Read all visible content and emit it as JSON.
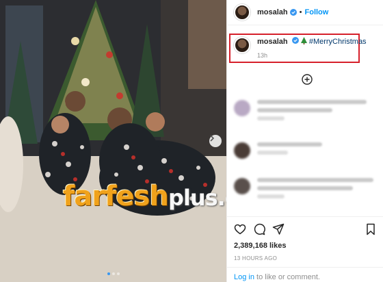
{
  "post": {
    "username": "mosalah",
    "follow_label": "Follow",
    "separator": "•",
    "caption_hashtag": "#MerryChristmas",
    "caption_time": "13h",
    "likes": "2,389,168 likes",
    "posted_ago": "13 HOURS AGO",
    "login_link": "Log in",
    "login_rest": " to like or comment."
  },
  "photo": {
    "watermark_main": "farfesh",
    "watermark_sub": "plus.com",
    "carousel_total": 3,
    "carousel_active": 1
  },
  "colors": {
    "accent_blue": "#0095f6",
    "highlight_box": "#d61f2a",
    "hashtag": "#00376b",
    "muted": "#8e8e8e"
  },
  "icons": {
    "verified": "verified-badge-icon",
    "load_more": "plus-circle-icon",
    "like": "heart-icon",
    "comment": "comment-icon",
    "share": "paper-plane-icon",
    "save": "bookmark-icon",
    "next": "chevron-right-icon"
  }
}
